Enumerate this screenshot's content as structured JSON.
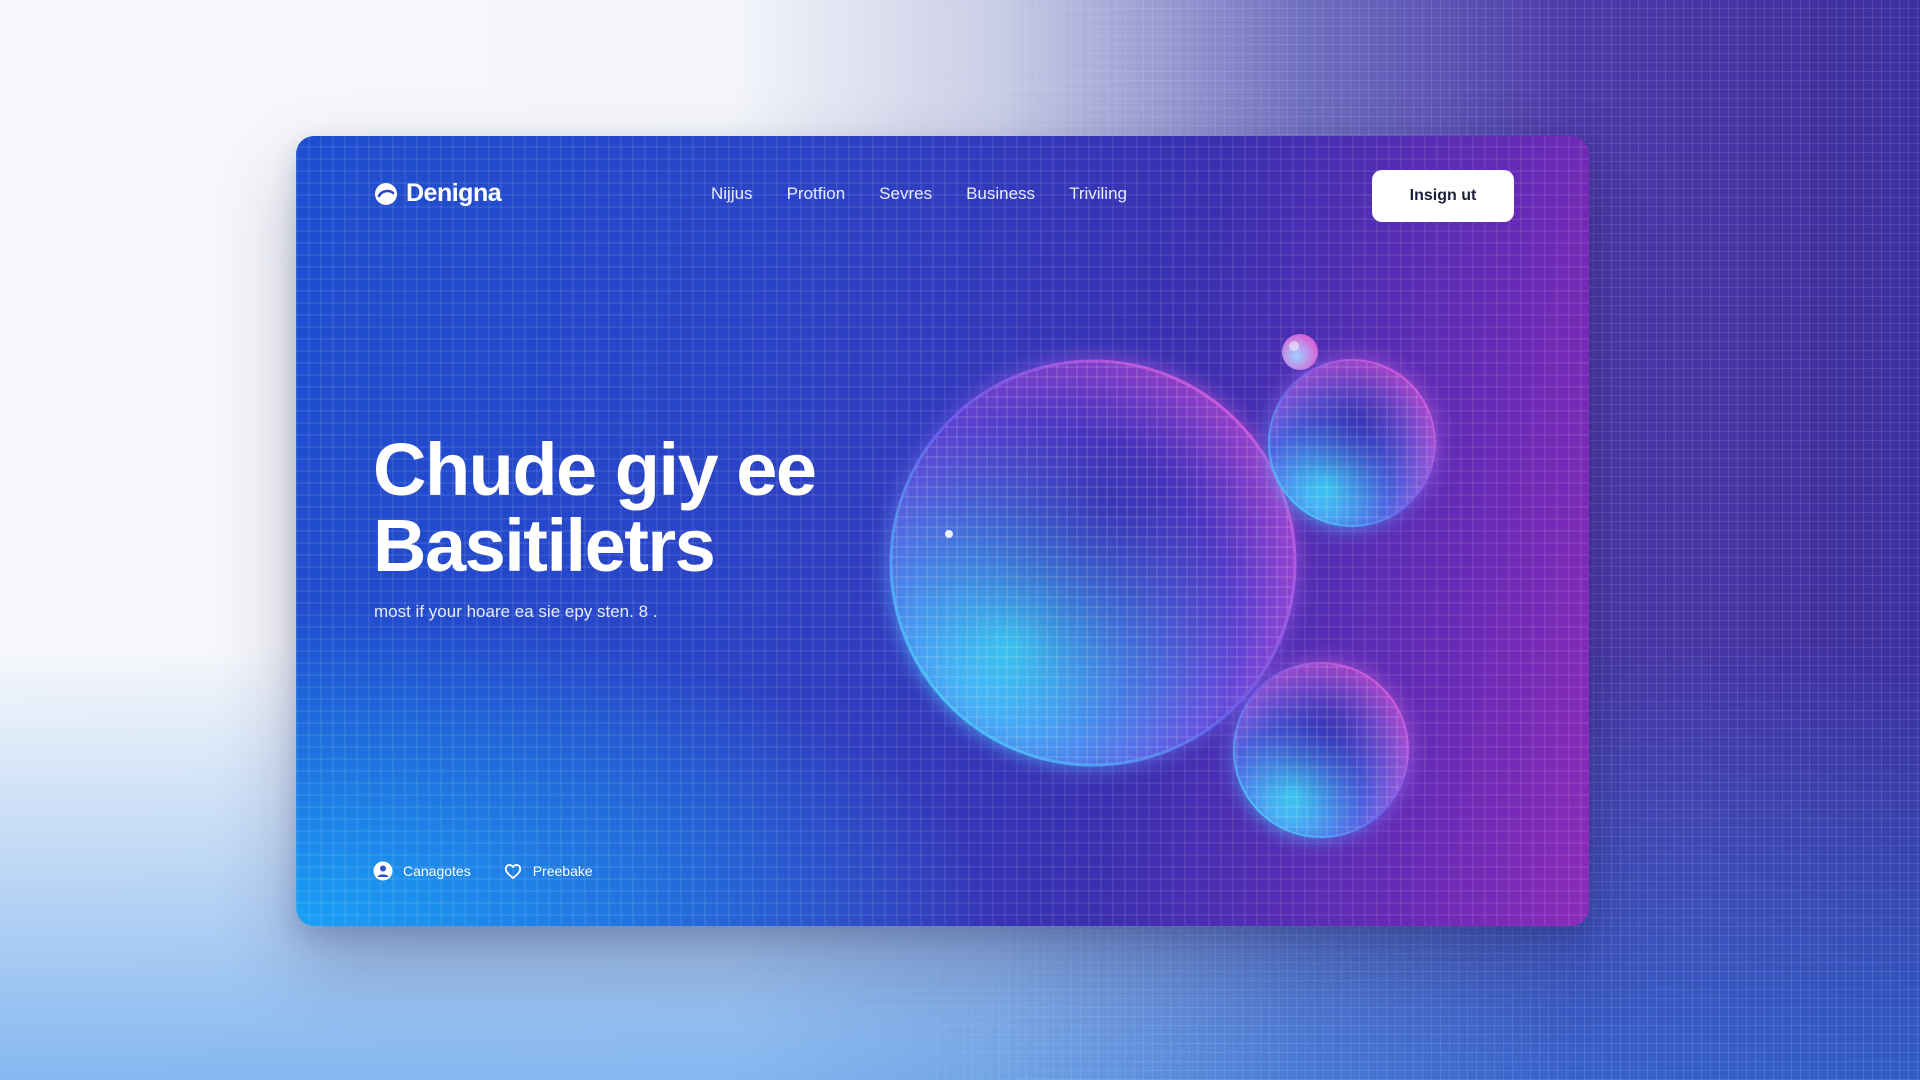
{
  "brand": {
    "name": "Denigna",
    "logo_icon": "swirl-logo-icon"
  },
  "nav": {
    "items": [
      {
        "label": "Nijjus"
      },
      {
        "label": "Protfion"
      },
      {
        "label": "Sevres"
      },
      {
        "label": "Business"
      },
      {
        "label": "Triviling"
      }
    ]
  },
  "header": {
    "signin_label": "Insign ut"
  },
  "hero": {
    "title_line1": "Chude giy ee",
    "title_line2": "Basitiletrs",
    "subtitle": "most if your hoare ea sie epy sten. 8 ."
  },
  "footer_links": [
    {
      "label": "Canagotes",
      "icon": "user-circle-icon"
    },
    {
      "label": "Preebake",
      "icon": "heart-outline-icon"
    }
  ],
  "colors": {
    "card_start": "#1d4fd0",
    "card_end": "#8a2bb8",
    "sphere_cyan": "#3ee6ff",
    "sphere_magenta": "#e04bd8",
    "button_bg": "#ffffff"
  }
}
